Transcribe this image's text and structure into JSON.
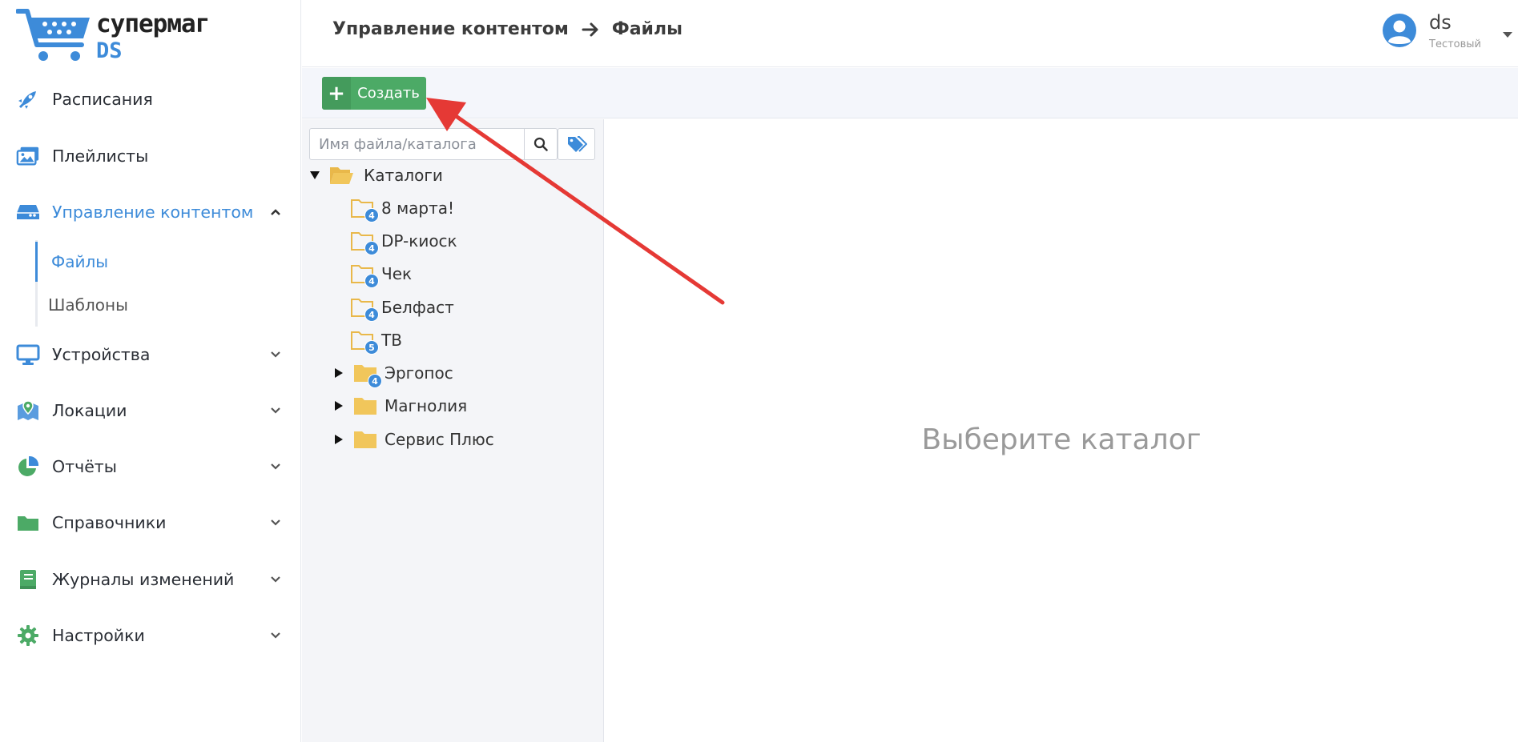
{
  "app": {
    "brand_name": "супермаг",
    "brand_sub": "DS",
    "brand_color": "#3d8bd9"
  },
  "sidebar": {
    "items": [
      {
        "label": "Расписания",
        "icon": "rocket-icon",
        "has_chevron": false
      },
      {
        "label": "Плейлисты",
        "icon": "images-icon",
        "has_chevron": false
      },
      {
        "label": "Управление контентом",
        "icon": "hdd-icon",
        "has_chevron": true,
        "expanded": true,
        "active": true
      },
      {
        "label": "Устройства",
        "icon": "monitor-icon",
        "has_chevron": true
      },
      {
        "label": "Локации",
        "icon": "map-marker-icon",
        "has_chevron": true
      },
      {
        "label": "Отчёты",
        "icon": "pie-chart-icon",
        "has_chevron": true
      },
      {
        "label": "Справочники",
        "icon": "folder-icon",
        "has_chevron": true
      },
      {
        "label": "Журналы изменений",
        "icon": "book-icon",
        "has_chevron": true
      },
      {
        "label": "Настройки",
        "icon": "gear-icon",
        "has_chevron": true
      }
    ],
    "subitems": [
      {
        "label": "Файлы",
        "active": true
      },
      {
        "label": "Шаблоны",
        "active": false
      }
    ]
  },
  "header": {
    "breadcrumb_parent": "Управление контентом",
    "breadcrumb_current": "Файлы",
    "user_name": "ds",
    "user_role": "Тестовый"
  },
  "toolbar": {
    "create_label": "Создать",
    "create_color": "#4caa66"
  },
  "filetree": {
    "search_placeholder": "Имя файла/каталога",
    "root_label": "Каталоги",
    "folders": [
      {
        "label": "8 марта!",
        "badge": "4"
      },
      {
        "label": "DP-киоск",
        "badge": "4"
      },
      {
        "label": "Чек",
        "badge": "4"
      },
      {
        "label": "Белфаст",
        "badge": "4"
      },
      {
        "label": "ТВ",
        "badge": "5"
      },
      {
        "label": "Эргопос",
        "badge": "4",
        "collapsed": true
      },
      {
        "label": "Магнолия",
        "collapsed": true
      },
      {
        "label": "Сервис Плюс",
        "collapsed": true
      }
    ]
  },
  "main": {
    "empty_text": "Выберите каталог"
  },
  "annotation": {
    "arrow_color": "#e53935"
  }
}
